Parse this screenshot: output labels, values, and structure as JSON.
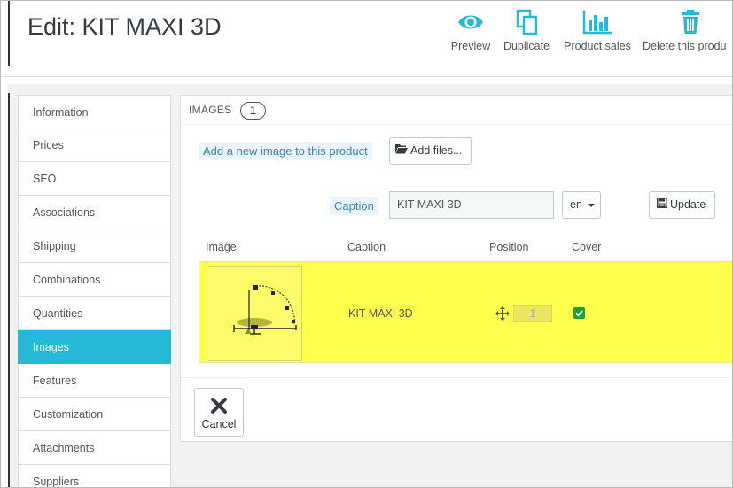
{
  "header": {
    "title": "Edit: KIT MAXI 3D",
    "toolbar": [
      {
        "label": "Preview",
        "icon": "eye-icon"
      },
      {
        "label": "Duplicate",
        "icon": "copy-icon"
      },
      {
        "label": "Product sales",
        "icon": "bar-chart-icon"
      },
      {
        "label": "Delete this produ",
        "icon": "trash-icon"
      }
    ]
  },
  "nav": {
    "items": [
      {
        "label": "Information"
      },
      {
        "label": "Prices"
      },
      {
        "label": "SEO"
      },
      {
        "label": "Associations"
      },
      {
        "label": "Shipping"
      },
      {
        "label": "Combinations"
      },
      {
        "label": "Quantities"
      },
      {
        "label": "Images"
      },
      {
        "label": "Features"
      },
      {
        "label": "Customization"
      },
      {
        "label": "Attachments"
      },
      {
        "label": "Suppliers"
      }
    ],
    "active_index": 7
  },
  "panel": {
    "heading": "IMAGES",
    "count": "1",
    "add_image_label": "Add a new image to this product",
    "add_files_label": "Add files...",
    "caption_label": "Caption",
    "caption_value": "KIT MAXI 3D",
    "language": "en",
    "update_label": "Update",
    "columns": {
      "image": "Image",
      "caption": "Caption",
      "position": "Position",
      "cover": "Cover"
    },
    "rows": [
      {
        "caption": "KIT MAXI 3D",
        "position": "1",
        "cover": true
      }
    ],
    "cancel_label": "Cancel"
  },
  "colors": {
    "accent": "#25b9d7",
    "highlight": "#ffff4d",
    "label_bg": "#eaf4fa",
    "label_text": "#3586ae",
    "cover_checked": "#1e9e3e"
  }
}
